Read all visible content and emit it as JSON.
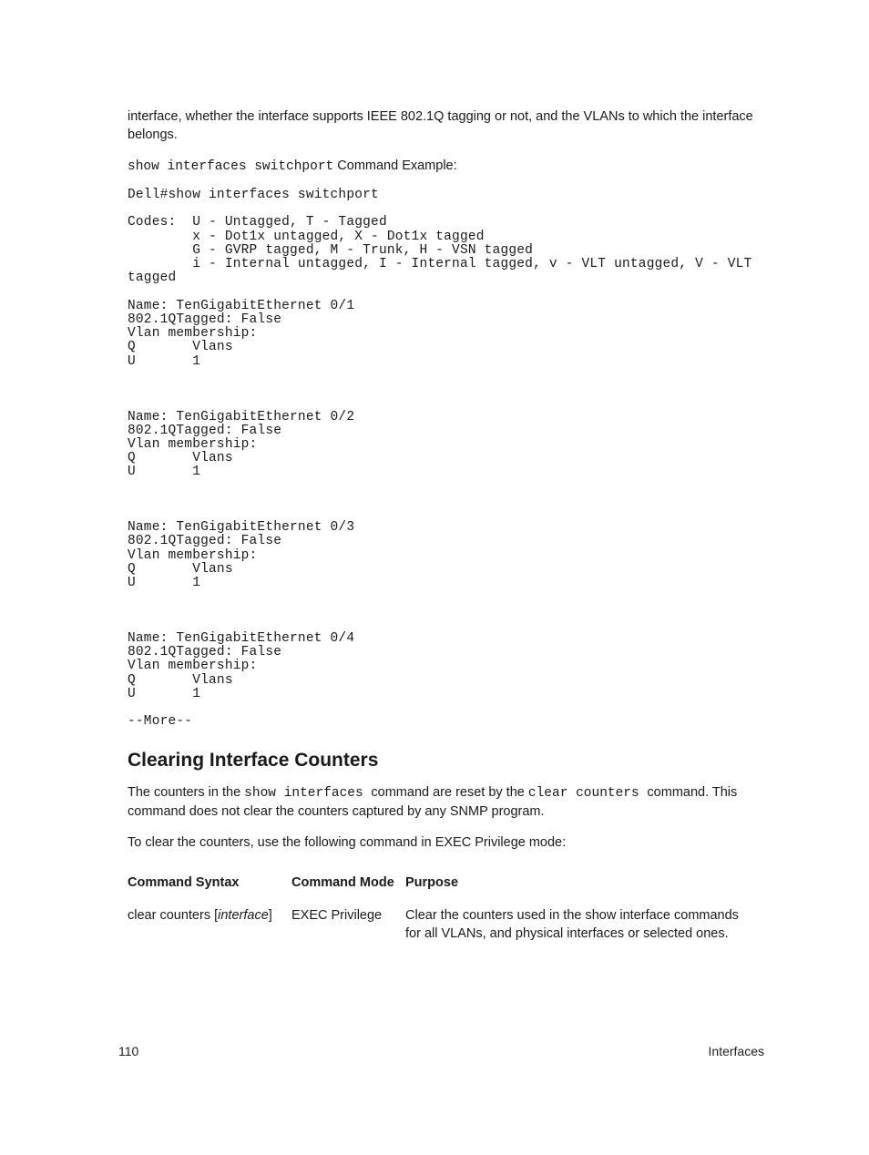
{
  "intro_para": "interface, whether the interface supports IEEE 802.1Q tagging or not, and the VLANs to which the interface belongs.",
  "caption_code": "show interfaces switchport",
  "caption_text": " Command Example:",
  "code_block": "Dell#show interfaces switchport\n\nCodes:  U - Untagged, T - Tagged\n        x - Dot1x untagged, X - Dot1x tagged\n        G - GVRP tagged, M - Trunk, H - VSN tagged\n        i - Internal untagged, I - Internal tagged, v - VLT untagged, V - VLT\ntagged\n\nName: TenGigabitEthernet 0/1\n802.1QTagged: False\nVlan membership:\nQ       Vlans\nU       1\n\n\n\nName: TenGigabitEthernet 0/2\n802.1QTagged: False\nVlan membership:\nQ       Vlans\nU       1\n\n\n\nName: TenGigabitEthernet 0/3\n802.1QTagged: False\nVlan membership:\nQ       Vlans\nU       1\n\n\n\nName: TenGigabitEthernet 0/4\n802.1QTagged: False\nVlan membership:\nQ       Vlans\nU       1\n\n--More--",
  "section_heading": "Clearing Interface Counters",
  "para2_pre": "The counters in the ",
  "para2_code1": "show interfaces ",
  "para2_mid": "command are reset by the ",
  "para2_code2": "clear counters ",
  "para2_post": "command. This command does not clear the counters captured by any SNMP program.",
  "para3": "To clear the counters, use the following command in EXEC Privilege mode:",
  "table": {
    "headers": {
      "syntax": "Command Syntax",
      "mode": "Command Mode",
      "purpose": "Purpose"
    },
    "row1": {
      "syntax_pre": "clear counters [",
      "syntax_ital": "interface",
      "syntax_post": "]",
      "mode": "EXEC Privilege",
      "purpose": "Clear the counters used in the show interface commands for all VLANs, and physical interfaces or selected ones."
    }
  },
  "footer": {
    "page": "110",
    "chapter": "Interfaces"
  }
}
